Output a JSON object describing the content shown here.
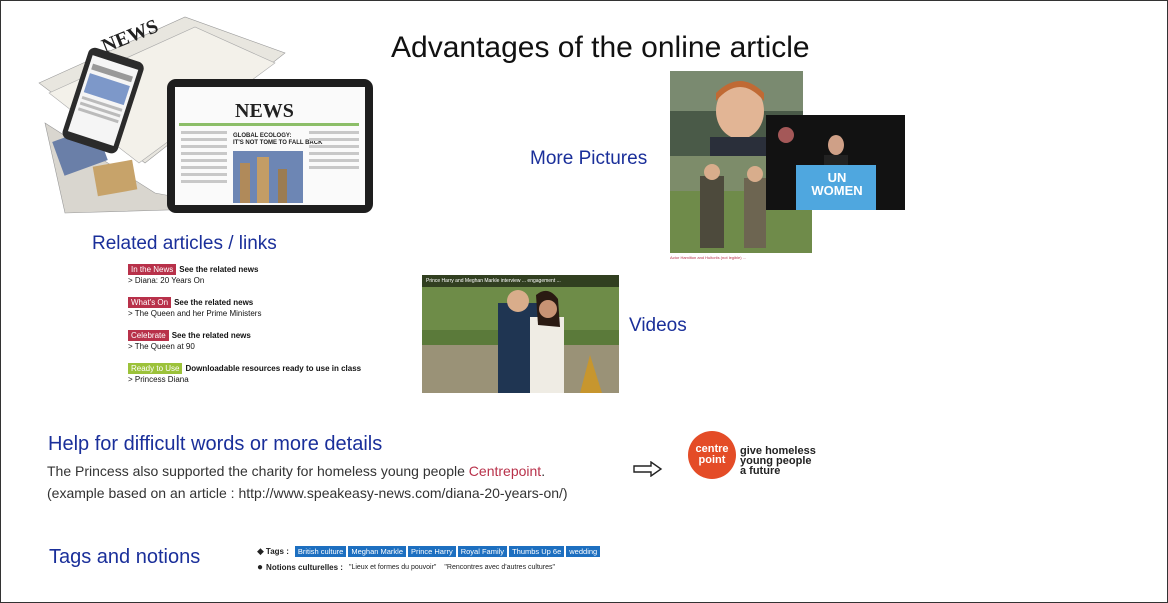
{
  "title": "Advantages of the online article",
  "sections": {
    "more_pictures": "More Pictures",
    "related": "Related articles / links",
    "videos": "Videos",
    "help": "Help for difficult words or more details",
    "tags_notions": "Tags and notions"
  },
  "links": [
    {
      "badge": "In the News",
      "badge_color": "#b8314a",
      "label": "See the related news",
      "sub": "> Diana: 20 Years On"
    },
    {
      "badge": "What's On",
      "badge_color": "#b8314a",
      "label": "See the related news",
      "sub": "> The Queen and her Prime Ministers"
    },
    {
      "badge": "Celebrate",
      "badge_color": "#b8314a",
      "label": "See the related news",
      "sub": "> The Queen at 90"
    },
    {
      "badge": "Ready to Use",
      "badge_color": "#9cc23a",
      "label": "Downloadable resources ready to use in class",
      "sub": "> Princess Diana"
    }
  ],
  "photos": {
    "caption": "Actor Hamilton and Hultoriis (not legible) ...",
    "un_logo": "UN WOMEN"
  },
  "video": {
    "title_bar": "Prince Harry and Meghan Markle interview ... engagement ..."
  },
  "help": {
    "sentence_before": "The Princess also supported the charity for homeless young people ",
    "link": "Centrepoint",
    "sentence_after": ".",
    "example": "(example based on an article : http://www.speakeasy-news.com/diana-20-years-on/)"
  },
  "centrepoint_logo": {
    "line1": "centre",
    "line2": "point",
    "tagline1": "give homeless",
    "tagline2": "young people",
    "tagline3": "a future"
  },
  "tags": {
    "label": "Tags :",
    "items": [
      "British culture",
      "Meghan Markle",
      "Prince Harry",
      "Royal Family",
      "Thumbs Up 6e",
      "wedding"
    ],
    "notions_label": "Notions culturelles :",
    "notions": [
      "\"Lieux et formes du pouvoir\"",
      "\"Rencontres avec d'autres cultures\""
    ]
  },
  "colors": {
    "heading_blue": "#1a2f9a",
    "badge_red": "#b8314a",
    "badge_green": "#9cc23a",
    "tag_blue": "#1d6fc0",
    "centrepoint_orange": "#e44c27"
  }
}
